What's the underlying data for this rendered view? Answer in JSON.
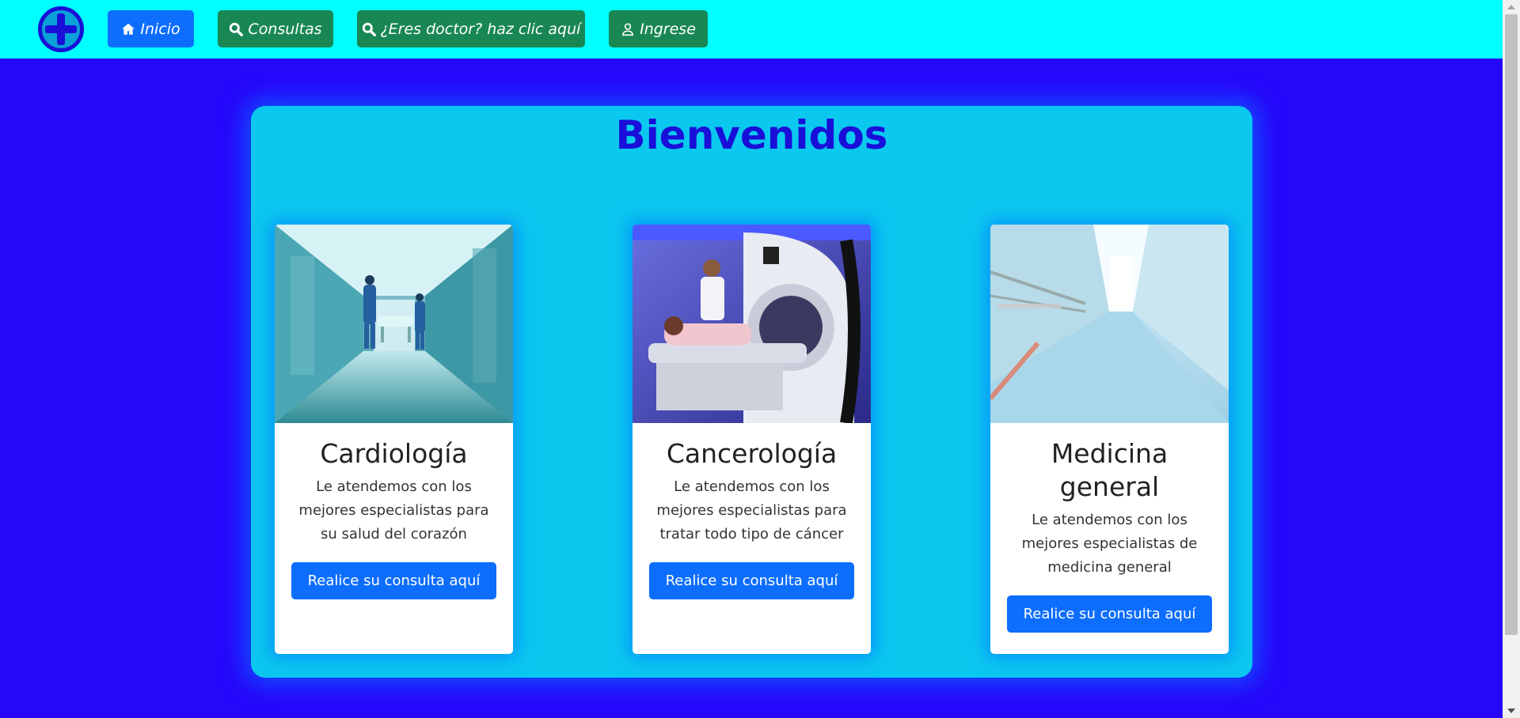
{
  "nav": {
    "logo_icon": "medical-cross-icon",
    "items": [
      {
        "label": "Inicio",
        "icon": "home-icon"
      },
      {
        "label": "Consultas",
        "icon": "search-icon"
      },
      {
        "label": "¿Eres doctor? haz clic aquí",
        "icon": "search-icon"
      },
      {
        "label": "Ingrese",
        "icon": "user-icon"
      }
    ]
  },
  "main": {
    "title": "Bienvenidos",
    "cards": [
      {
        "title": "Cardiología",
        "text": "Le atendemos con los mejores especialistas para su salud del corazón",
        "button": "Realice su consulta aquí",
        "image": "hospital-corridor-photo"
      },
      {
        "title": "Cancerología",
        "text": "Le atendemos con los mejores especialistas para tratar todo tipo de cáncer",
        "button": "Realice su consulta aquí",
        "image": "mri-scanner-photo"
      },
      {
        "title": "Medicina general",
        "text": "Le atendemos con los mejores especialistas de medicina general",
        "button": "Realice su consulta aquí",
        "image": "bright-corridor-photo"
      }
    ]
  },
  "colors": {
    "page_bg": "#2508fa",
    "navbar_bg": "#00ffff",
    "panel_bg": "#0bc8ef",
    "primary": "#0d6efd",
    "success": "#198754",
    "title": "#1a0fd8"
  }
}
